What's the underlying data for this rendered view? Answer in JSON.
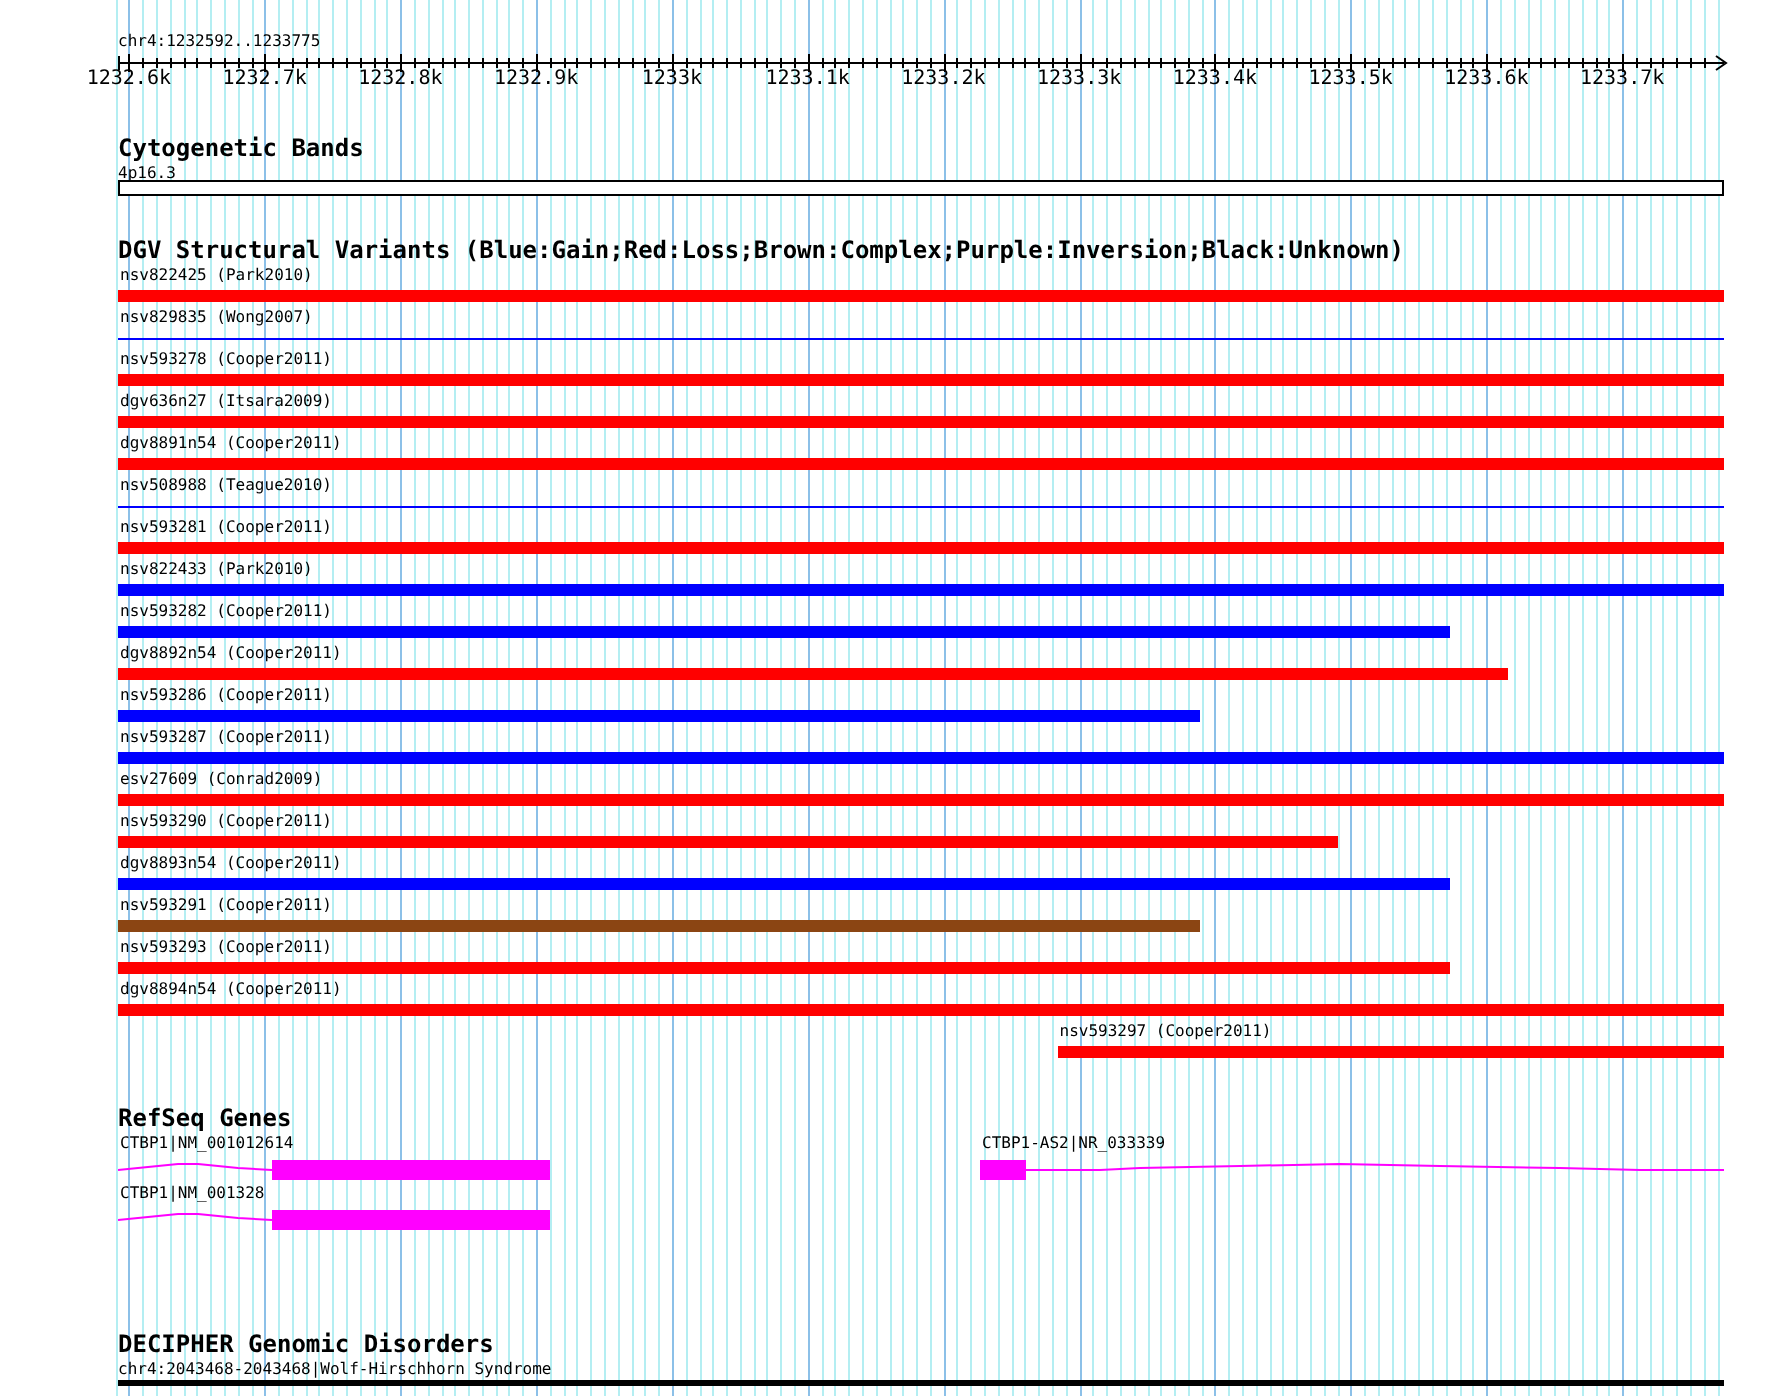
{
  "ruler": {
    "label": "chr4:1232592..1233775",
    "ticks": [
      "1232.6k",
      "1232.7k",
      "1232.8k",
      "1232.9k",
      "1233k",
      "1233.1k",
      "1233.2k",
      "1233.3k",
      "1233.4k",
      "1233.5k",
      "1233.6k",
      "1233.7k"
    ]
  },
  "cytoband_track": {
    "title": "Cytogenetic Bands",
    "band": "4p16.3"
  },
  "variant_track": {
    "title": "DGV Structural Variants (Blue:Gain;Red:Loss;Brown:Complex;Purple:Inversion;Black:Unknown)",
    "variants": [
      {
        "label": "nsv822425 (Park2010)",
        "kind": "bar",
        "color": "#ff0000"
      },
      {
        "label": "nsv829835 (Wong2007)",
        "kind": "line",
        "color": "#0000ff"
      },
      {
        "label": "nsv593278 (Cooper2011)",
        "kind": "bar",
        "color": "#ff0000"
      },
      {
        "label": "dgv636n27 (Itsara2009)",
        "kind": "bar",
        "color": "#ff0000"
      },
      {
        "label": "dgv8891n54 (Cooper2011)",
        "kind": "bar",
        "color": "#ff0000"
      },
      {
        "label": "nsv508988 (Teague2010)",
        "kind": "line",
        "color": "#0000ff"
      },
      {
        "label": "nsv593281 (Cooper2011)",
        "kind": "bar",
        "color": "#ff0000"
      },
      {
        "label": "nsv822433 (Park2010)",
        "kind": "bar",
        "color": "#0000ff"
      },
      {
        "label": "nsv593282 (Cooper2011)",
        "kind": "bar",
        "color": "#0000ff"
      },
      {
        "label": "dgv8892n54 (Cooper2011)",
        "kind": "bar",
        "color": "#ff0000"
      },
      {
        "label": "nsv593286 (Cooper2011)",
        "kind": "bar",
        "color": "#0000ff"
      },
      {
        "label": "nsv593287 (Cooper2011)",
        "kind": "bar",
        "color": "#0000ff"
      },
      {
        "label": "esv27609 (Conrad2009)",
        "kind": "bar",
        "color": "#ff0000"
      },
      {
        "label": "nsv593290 (Cooper2011)",
        "kind": "bar",
        "color": "#ff0000"
      },
      {
        "label": "dgv8893n54 (Cooper2011)",
        "kind": "bar",
        "color": "#0000ff"
      },
      {
        "label": "nsv593291 (Cooper2011)",
        "kind": "bar",
        "color": "#8b4513"
      },
      {
        "label": "nsv593293 (Cooper2011)",
        "kind": "bar",
        "color": "#ff0000"
      },
      {
        "label": "dgv8894n54 (Cooper2011)",
        "kind": "bar",
        "color": "#ff0000"
      },
      {
        "label": "nsv593297 (Cooper2011)",
        "kind": "bar",
        "color": "#ff0000"
      }
    ]
  },
  "gene_track": {
    "title": "RefSeq Genes",
    "rows": [
      {
        "genes": [
          {
            "label": "CTBP1|NM_001012614",
            "kind": "late-exon"
          },
          {
            "label": "CTBP1-AS2|NR_033339",
            "kind": "early-exon"
          }
        ]
      },
      {
        "genes": [
          {
            "label": "CTBP1|NM_001328",
            "kind": "late-exon"
          }
        ]
      }
    ]
  },
  "disorder_track": {
    "title": "DECIPHER Genomic Disorders",
    "label": "chr4:2043468-2043468|Wolf-Hirschhorn Syndrome"
  }
}
